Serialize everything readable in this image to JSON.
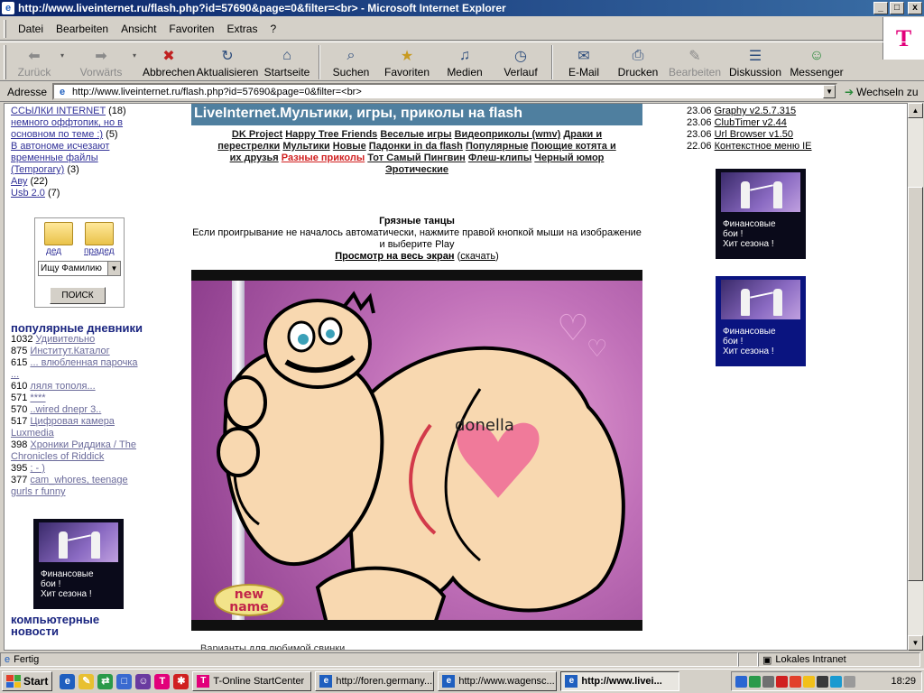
{
  "window": {
    "title": "http://www.liveinternet.ru/flash.php?id=57690&page=0&filter=<br> - Microsoft Internet Explorer",
    "controls": [
      "_",
      "□",
      "x"
    ]
  },
  "menu": [
    "Datei",
    "Bearbeiten",
    "Ansicht",
    "Favoriten",
    "Extras",
    "?"
  ],
  "brand_logo": "T",
  "toolbar": [
    {
      "label": "Zurück",
      "icon": "back-arrow-icon",
      "disabled": true
    },
    {
      "label": "Vorwärts",
      "icon": "forward-arrow-icon",
      "disabled": true
    },
    {
      "label": "Abbrechen",
      "icon": "stop-icon",
      "disabled": false
    },
    {
      "label": "Aktualisieren",
      "icon": "refresh-icon",
      "disabled": false
    },
    {
      "label": "Startseite",
      "icon": "home-icon",
      "disabled": false
    },
    {
      "label": "Suchen",
      "icon": "search-icon",
      "disabled": false
    },
    {
      "label": "Favoriten",
      "icon": "favorites-icon",
      "disabled": false
    },
    {
      "label": "Medien",
      "icon": "media-icon",
      "disabled": false
    },
    {
      "label": "Verlauf",
      "icon": "history-icon",
      "disabled": false
    },
    {
      "label": "E-Mail",
      "icon": "mail-icon",
      "disabled": false
    },
    {
      "label": "Drucken",
      "icon": "print-icon",
      "disabled": false
    },
    {
      "label": "Bearbeiten",
      "icon": "edit-icon",
      "disabled": true
    },
    {
      "label": "Diskussion",
      "icon": "discussion-icon",
      "disabled": false
    },
    {
      "label": "Messenger",
      "icon": "messenger-icon",
      "disabled": false
    }
  ],
  "address": {
    "label": "Adresse",
    "url": "http://www.liveinternet.ru/flash.php?id=57690&page=0&filter=<br>",
    "go_label": "Wechseln zu"
  },
  "left": {
    "links_top": [
      {
        "text": "ССЫЛКИ INTERNET",
        "count": "(18)"
      },
      {
        "text": "немного оффтопик, но в основном по теме :)",
        "count": "(5)"
      },
      {
        "text": "В автономе исчезают временные файлы (Temporary)",
        "count": "(3)"
      },
      {
        "text": "Аву",
        "count": "(22)"
      },
      {
        "text": "Usb 2.0",
        "count": "(7)"
      }
    ],
    "search": {
      "folder1": "дед",
      "folder2": "прадед",
      "select_value": "Ищу Фамилию",
      "button": "ПОИСК"
    },
    "popular_title": "популярные дневники",
    "popular": [
      {
        "count": "1032",
        "name": "Удивительно"
      },
      {
        "count": "875",
        "name": "Институт.Каталог"
      },
      {
        "count": "615",
        "name": "... влюбленная парочка ..."
      },
      {
        "count": "610",
        "name": "ляля тополя..."
      },
      {
        "count": "571",
        "name": "****"
      },
      {
        "count": "570",
        "name": "..wired dnepr 3.."
      },
      {
        "count": "517",
        "name": "Цифровая камера Luxmedia"
      },
      {
        "count": "398",
        "name": "Хроники Риддика / The Chronicles of Riddick"
      },
      {
        "count": "395",
        "name": "; - )"
      },
      {
        "count": "377",
        "name": "cam_whores, teenage gurls r funny"
      }
    ],
    "bottom_title": "компьютерные новости"
  },
  "ad": {
    "line1": "Финансовые",
    "line2": "бои !",
    "line3": "Хит сезона !"
  },
  "center": {
    "banner": "LiveInternet.Мультики, игры, приколы на flash",
    "cats_line1": [
      "DK Project",
      "Happy Tree Friends",
      "Веселые игры",
      "Видеоприколы (wmv)",
      "Драки и"
    ],
    "cats_line2": [
      "перестрелки",
      "Мультики",
      "Новые",
      "Падонки in da flash",
      "Популярные",
      "Поющие котята и"
    ],
    "cats_line3": [
      "их друзья",
      "Разные приколы",
      "Тот Самый Пингвин",
      "Флеш-клипы",
      "Черный юмор"
    ],
    "cats_line4": [
      "Эротические"
    ],
    "video_title": "Грязные танцы",
    "instr1": "Если проигрывание не началось автоматически, нажмите правой кнопкой мыши на изображение",
    "instr2": "и выберите Play",
    "fullscreen": "Просмотр на весь экран",
    "download": "скачать",
    "flash_tattoo": "donella",
    "flash_badge_line1": "new",
    "flash_badge_line2": "name",
    "below_text": "Варианты для любимой свинки ..."
  },
  "right": {
    "updates": [
      {
        "date": "23.06",
        "name": "Graphy v2.5.7.315"
      },
      {
        "date": "23.06",
        "name": "ClubTimer v2.44"
      },
      {
        "date": "23.06",
        "name": "Url Browser v1.50"
      },
      {
        "date": "22.06",
        "name": "Контекстное меню IE"
      }
    ]
  },
  "status": {
    "left": "Fertig",
    "zone": "Lokales Intranet"
  },
  "taskbar": {
    "start": "Start",
    "tasks": [
      {
        "label": "T-Online StartCenter",
        "active": false
      },
      {
        "label": "http://foren.germany...",
        "active": false
      },
      {
        "label": "http://www.wagensc...",
        "active": false
      },
      {
        "label": "http://www.livei...",
        "active": true
      }
    ],
    "clock": "18:29"
  }
}
